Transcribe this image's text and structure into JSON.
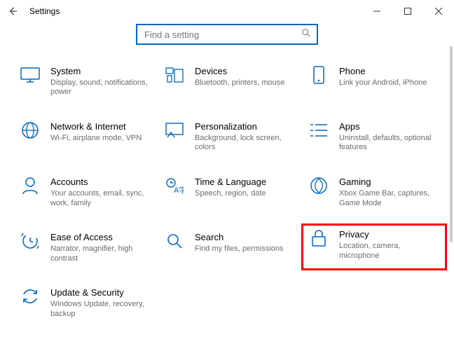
{
  "window": {
    "title": "Settings"
  },
  "search": {
    "placeholder": "Find a setting"
  },
  "categories": [
    {
      "id": "system",
      "title": "System",
      "sub": "Display, sound, notifications, power"
    },
    {
      "id": "devices",
      "title": "Devices",
      "sub": "Bluetooth, printers, mouse"
    },
    {
      "id": "phone",
      "title": "Phone",
      "sub": "Link your Android, iPhone"
    },
    {
      "id": "network",
      "title": "Network & Internet",
      "sub": "Wi-Fi, airplane mode, VPN"
    },
    {
      "id": "personalization",
      "title": "Personalization",
      "sub": "Background, lock screen, colors"
    },
    {
      "id": "apps",
      "title": "Apps",
      "sub": "Uninstall, defaults, optional features"
    },
    {
      "id": "accounts",
      "title": "Accounts",
      "sub": "Your accounts, email, sync, work, family"
    },
    {
      "id": "time",
      "title": "Time & Language",
      "sub": "Speech, region, date"
    },
    {
      "id": "gaming",
      "title": "Gaming",
      "sub": "Xbox Game Bar, captures, Game Mode"
    },
    {
      "id": "ease",
      "title": "Ease of Access",
      "sub": "Narrator, magnifier, high contrast"
    },
    {
      "id": "search",
      "title": "Search",
      "sub": "Find my files, permissions"
    },
    {
      "id": "privacy",
      "title": "Privacy",
      "sub": "Location, camera, microphone",
      "highlighted": true
    },
    {
      "id": "update",
      "title": "Update & Security",
      "sub": "Windows Update, recovery, backup"
    }
  ]
}
